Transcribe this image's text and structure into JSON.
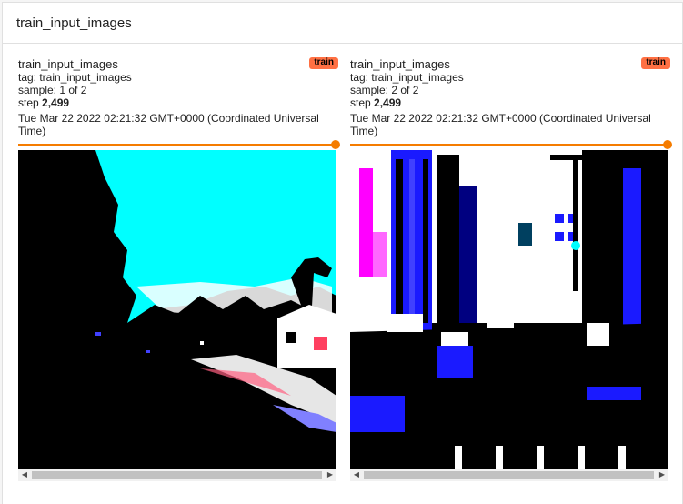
{
  "panel": {
    "title": "train_input_images"
  },
  "cards": [
    {
      "title": "train_input_images",
      "run_badge": "train",
      "tag": "tag: train_input_images",
      "sample": "sample: 1 of 2",
      "step_label": "step ",
      "step_value": "2,499",
      "time": "Tue Mar 22 2022 02:21:32 GMT+0000 (Coordinated Universal Time)",
      "slider_value": 1.0,
      "scroll_arrow_left": "◀",
      "scroll_arrow_right": "▶"
    },
    {
      "title": "train_input_images",
      "run_badge": "train",
      "tag": "tag: train_input_images",
      "sample": "sample: 2 of 2",
      "step_label": "step ",
      "step_value": "2,499",
      "time": "Tue Mar 22 2022 02:21:32 GMT+0000 (Coordinated Universal Time)",
      "slider_value": 1.0,
      "scroll_arrow_left": "◀",
      "scroll_arrow_right": "▶"
    }
  ],
  "colors": {
    "accent": "#f57c00",
    "badge": "#ff7043",
    "sky": "#00ffff",
    "building_blue": "#1a1aff",
    "magenta": "#ff00ff"
  }
}
